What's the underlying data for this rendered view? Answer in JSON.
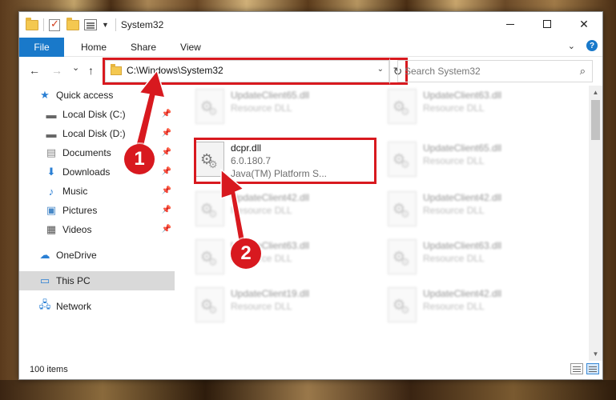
{
  "window": {
    "title": "System32",
    "controls": {
      "minimize": "–",
      "maximize": "□",
      "close": "✕"
    }
  },
  "ribbon": {
    "tabs": [
      "File",
      "Home",
      "Share",
      "View"
    ],
    "expand_icon": "chevron-down-icon",
    "help_label": "?"
  },
  "nav": {
    "back": "←",
    "forward": "→",
    "recent": "⌄",
    "up": "↑",
    "address": "C:\\Windows\\System32",
    "address_drop": "⌄",
    "refresh": "↻",
    "search_placeholder": "Search System32",
    "search_icon": "⌕"
  },
  "sidebar": {
    "quick_access": "Quick access",
    "items": [
      {
        "label": "Local Disk (C:)",
        "icon": "drive-icon"
      },
      {
        "label": "Local Disk (D:)",
        "icon": "drive-icon"
      },
      {
        "label": "Documents",
        "icon": "documents-icon"
      },
      {
        "label": "Downloads",
        "icon": "downloads-icon"
      },
      {
        "label": "Music",
        "icon": "music-icon"
      },
      {
        "label": "Pictures",
        "icon": "pictures-icon"
      },
      {
        "label": "Videos",
        "icon": "videos-icon"
      }
    ],
    "onedrive": "OneDrive",
    "this_pc": "This PC",
    "network": "Network"
  },
  "files": [
    {
      "name": "UpdateClient65.dll",
      "sub": "Resource DLL"
    },
    {
      "name": "UpdateClient63.dll",
      "sub": "Resource DLL"
    },
    {
      "name": "dcpr.dll",
      "sub": "6.0.180.7",
      "sub2": "Java(TM) Platform S..."
    },
    {
      "name": "UpdateClient65.dll",
      "sub": "Resource DLL"
    },
    {
      "name": "UpdateClient42.dll",
      "sub": "Resource DLL"
    },
    {
      "name": "UpdateClient42.dll",
      "sub": "Resource DLL"
    },
    {
      "name": "UpdateClient63.dll",
      "sub": "Resource DLL"
    },
    {
      "name": "UpdateClient63.dll",
      "sub": "Resource DLL"
    },
    {
      "name": "UpdateClient19.dll",
      "sub": "Resource DLL"
    },
    {
      "name": "UpdateClient42.dll",
      "sub": "Resource DLL"
    }
  ],
  "status": {
    "count": "100 items"
  },
  "callouts": [
    "1",
    "2"
  ],
  "colors": {
    "accent": "#1979ca",
    "highlight": "#d8191f",
    "selected": "#d9d9d9"
  }
}
